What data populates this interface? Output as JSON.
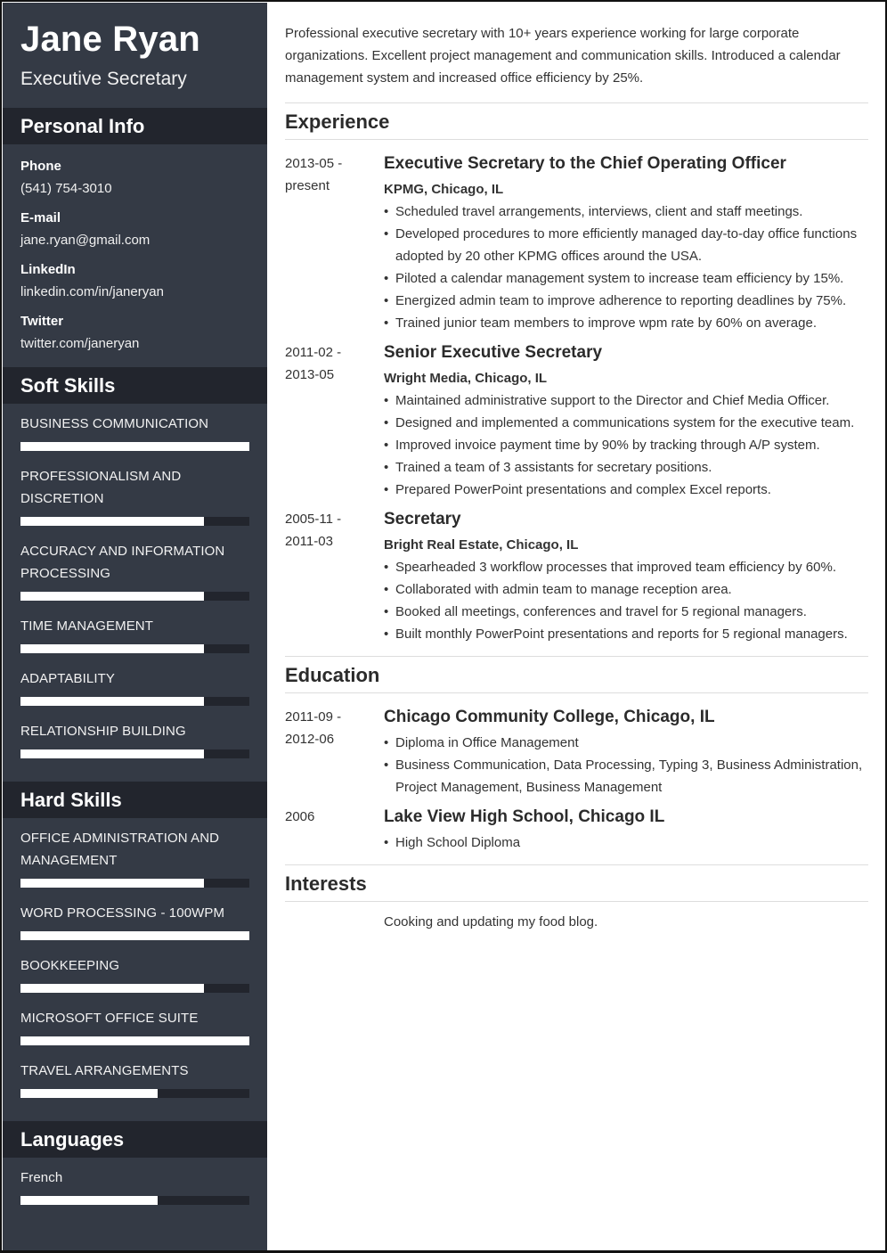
{
  "header": {
    "name": "Jane Ryan",
    "role": "Executive Secretary"
  },
  "colors": {
    "sidebar_bg": "#343a45",
    "sidebar_heading_bg": "#22252d",
    "bar_fill": "#ffffff",
    "bar_track": "#22252d",
    "text_main": "#333333"
  },
  "personal_info": {
    "title": "Personal Info",
    "items": [
      {
        "label": "Phone",
        "value": "(541) 754-3010"
      },
      {
        "label": "E-mail",
        "value": "jane.ryan@gmail.com"
      },
      {
        "label": "LinkedIn",
        "value": "linkedin.com/in/janeryan"
      },
      {
        "label": "Twitter",
        "value": "twitter.com/janeryan"
      }
    ]
  },
  "soft_skills": {
    "title": "Soft Skills",
    "items": [
      {
        "name": "Business Communication",
        "level": 1.0
      },
      {
        "name": "Professionalism and Discretion",
        "level": 0.8
      },
      {
        "name": "Accuracy and Information Processing",
        "level": 0.8
      },
      {
        "name": "Time Management",
        "level": 0.8
      },
      {
        "name": "Adaptability",
        "level": 0.8
      },
      {
        "name": "Relationship Building",
        "level": 0.8
      }
    ]
  },
  "hard_skills": {
    "title": "Hard Skills",
    "items": [
      {
        "name": "Office Administration and Management",
        "level": 0.8
      },
      {
        "name": "Word Processing - 100WPM",
        "level": 1.0
      },
      {
        "name": "Bookkeeping",
        "level": 0.8
      },
      {
        "name": "Microsoft Office Suite",
        "level": 1.0
      },
      {
        "name": "Travel Arrangements",
        "level": 0.6
      }
    ]
  },
  "languages": {
    "title": "Languages",
    "items": [
      {
        "name": "French",
        "level": 0.6
      }
    ]
  },
  "summary": "Professional executive secretary with 10+ years experience working for large corporate organizations. Excellent project management and communication skills. Introduced a calendar management system and increased office efficiency by 25%.",
  "experience": {
    "title": "Experience",
    "entries": [
      {
        "date_start": "2013-05 -",
        "date_end": "present",
        "title": "Executive Secretary to the Chief Operating Officer",
        "org": "KPMG, Chicago, IL",
        "bullets": [
          "Scheduled travel arrangements, interviews, client and staff meetings.",
          "Developed procedures to more efficiently managed day-to-day office functions adopted by 20 other KPMG offices around the USA.",
          "Piloted a calendar management system to increase team efficiency by 15%.",
          "Energized admin team to improve adherence to reporting deadlines by 75%.",
          "Trained junior team members to improve wpm rate by 60% on average."
        ]
      },
      {
        "date_start": "2011-02 -",
        "date_end": "2013-05",
        "title": "Senior Executive Secretary",
        "org": "Wright Media, Chicago, IL",
        "bullets": [
          "Maintained administrative support to the Director and Chief Media Officer.",
          "Designed and implemented a communications system for the executive team.",
          "Improved invoice payment time by 90% by tracking through A/P system.",
          "Trained a team of 3 assistants for secretary positions.",
          "Prepared PowerPoint presentations and complex Excel reports."
        ]
      },
      {
        "date_start": "2005-11 -",
        "date_end": "2011-03",
        "title": "Secretary",
        "org": "Bright Real Estate, Chicago, IL",
        "bullets": [
          "Spearheaded 3 workflow processes that improved team efficiency by 60%.",
          "Collaborated with admin team to manage reception area.",
          "Booked all meetings, conferences and travel for 5 regional managers.",
          "Built monthly PowerPoint presentations and reports for 5 regional managers."
        ]
      }
    ]
  },
  "education": {
    "title": "Education",
    "entries": [
      {
        "date_start": "2011-09 -",
        "date_end": "2012-06",
        "title": "Chicago Community College, Chicago, IL",
        "bullets": [
          "Diploma in Office Management",
          "Business Communication, Data Processing, Typing 3, Business Administration, Project Management, Business Management"
        ]
      },
      {
        "date_start": "2006",
        "date_end": "",
        "title": "Lake View High School, Chicago IL",
        "bullets": [
          "High School Diploma"
        ]
      }
    ]
  },
  "interests": {
    "title": "Interests",
    "text": "Cooking and updating my food blog."
  }
}
